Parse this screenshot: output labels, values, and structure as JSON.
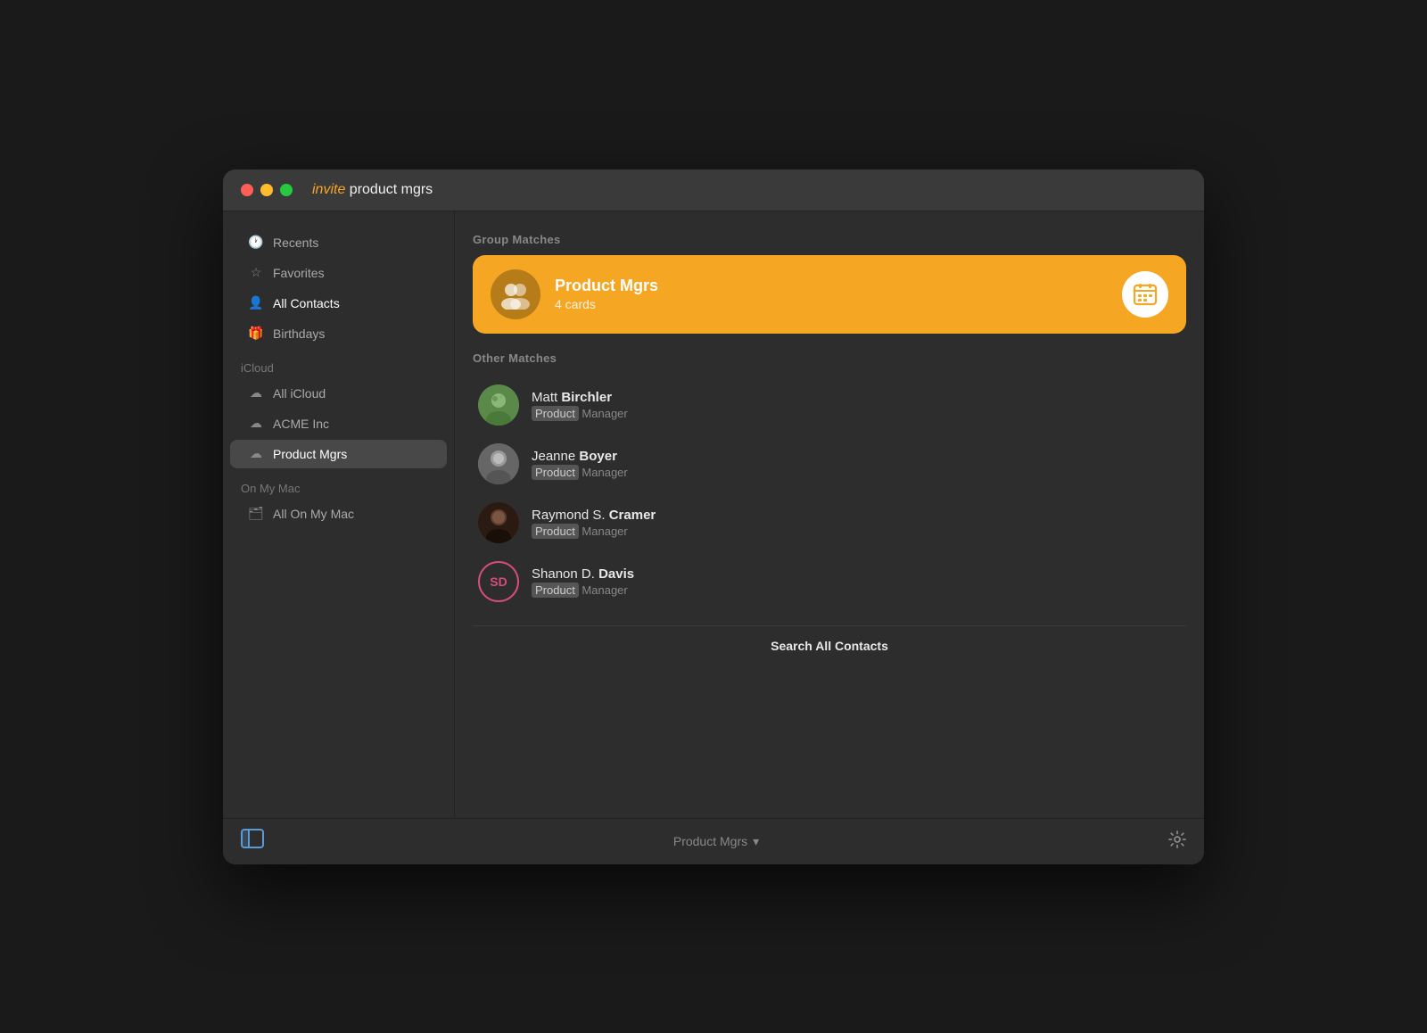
{
  "titlebar": {
    "title_highlight": "invite",
    "title_rest": " product mgrs"
  },
  "sidebar": {
    "section_top": {
      "items": [
        {
          "id": "recents",
          "label": "Recents",
          "icon": "🕐"
        },
        {
          "id": "favorites",
          "label": "Favorites",
          "icon": "☆"
        },
        {
          "id": "all-contacts",
          "label": "All Contacts",
          "icon": "👤",
          "bold": true
        },
        {
          "id": "birthdays",
          "label": "Birthdays",
          "icon": "🎁"
        }
      ]
    },
    "icloud_label": "iCloud",
    "icloud_items": [
      {
        "id": "all-icloud",
        "label": "All iCloud",
        "icon": "☁"
      },
      {
        "id": "acme-inc",
        "label": "ACME Inc",
        "icon": "☁"
      },
      {
        "id": "product-mgrs",
        "label": "Product Mgrs",
        "icon": "☁",
        "active": true
      }
    ],
    "on_my_mac_label": "On My Mac",
    "on_my_mac_items": [
      {
        "id": "all-on-my-mac",
        "label": "All On My Mac",
        "icon": "🗂"
      }
    ]
  },
  "content": {
    "group_matches_label": "Group Matches",
    "group": {
      "name": "Product Mgrs",
      "count": "4 cards",
      "icon": "calendar"
    },
    "other_matches_label": "Other Matches",
    "contacts": [
      {
        "id": "matt-birchler",
        "first": "Matt ",
        "last": "Birchler",
        "title_prefix": "Product",
        "title_rest": " Manager",
        "avatar_type": "photo",
        "avatar_class": "avatar-matt"
      },
      {
        "id": "jeanne-boyer",
        "first": "Jeanne ",
        "last": "Boyer",
        "title_prefix": "Product",
        "title_rest": " Manager",
        "avatar_type": "photo",
        "avatar_class": "avatar-jeanne"
      },
      {
        "id": "raymond-cramer",
        "first": "Raymond S. ",
        "last": "Cramer",
        "title_prefix": "Product",
        "title_rest": " Manager",
        "avatar_type": "photo",
        "avatar_class": "avatar-raymond"
      },
      {
        "id": "shanon-davis",
        "first": "Shanon D. ",
        "last": "Davis",
        "title_prefix": "Product",
        "title_rest": " Manager",
        "avatar_type": "initials",
        "initials": "SD"
      }
    ],
    "search_all_label": "Search All Contacts"
  },
  "bottombar": {
    "center_label": "Product Mgrs",
    "chevron": "▾"
  }
}
